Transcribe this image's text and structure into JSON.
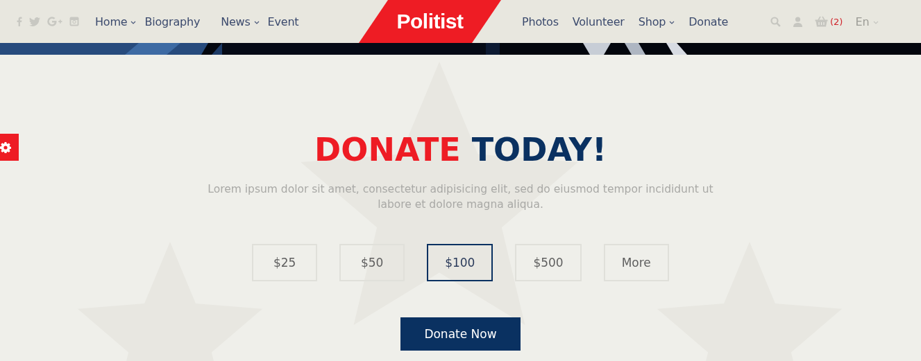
{
  "header": {
    "social": [
      {
        "kind": "facebook"
      },
      {
        "kind": "twitter"
      },
      {
        "kind": "googleplus"
      },
      {
        "kind": "instagram"
      }
    ],
    "nav_left": [
      {
        "label": "Home",
        "has_dropdown": true
      },
      {
        "label": "Biography",
        "has_dropdown": false
      },
      {
        "label": "News",
        "has_dropdown": true
      },
      {
        "label": "Event",
        "has_dropdown": false
      }
    ],
    "logo": "Politist",
    "nav_right": [
      {
        "label": "Photos",
        "has_dropdown": false
      },
      {
        "label": "Volunteer",
        "has_dropdown": false
      },
      {
        "label": "Shop",
        "has_dropdown": true
      },
      {
        "label": "Donate",
        "has_dropdown": false
      }
    ],
    "cart_count": "(2)",
    "language": "En"
  },
  "donate": {
    "title_accent": "DONATE",
    "title_rest": "TODAY!",
    "description": "Lorem ipsum dolor sit amet, consectetur adipisicing elit, sed do eiusmod tempor incididunt ut labore et dolore magna aliqua.",
    "amounts": [
      {
        "label": "$25",
        "selected": false
      },
      {
        "label": "$50",
        "selected": false
      },
      {
        "label": "$100",
        "selected": true
      },
      {
        "label": "$500",
        "selected": false
      },
      {
        "label": "More",
        "selected": false
      }
    ],
    "button": "Donate Now"
  }
}
